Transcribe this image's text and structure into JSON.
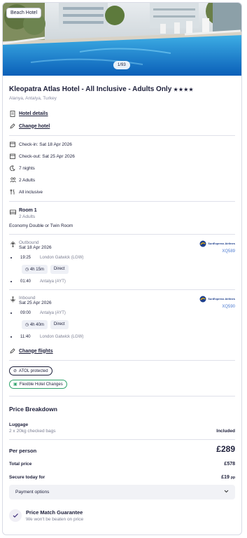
{
  "hero": {
    "tag": "Beach Hotel",
    "counter": "1/93"
  },
  "hotel": {
    "name": "Kleopatra Atlas Hotel - All Inclusive - Adults Only",
    "stars": "★★★★",
    "location": "Alanya, Antalya, Turkey",
    "details_link": "Hotel details",
    "change_link": "Change hotel"
  },
  "stay": {
    "checkin": "Check-in: Sat 18 Apr 2026",
    "checkout": "Check-out: Sat 25 Apr 2026",
    "nights": "7 nights",
    "adults": "2 Adults",
    "board": "All inclusive"
  },
  "room": {
    "title": "Room 1",
    "adults": "2 Adults",
    "type": "Economy Double or Twin Room"
  },
  "outbound": {
    "label": "Outbound",
    "date": "Sat 18 Apr 2026",
    "airline": "SunExpress Airlines",
    "code": "XQ589",
    "dep_time": "19:25",
    "dep_airport": "London Gatwick (LGW)",
    "duration": "4h 15m",
    "stops": "Direct",
    "arr_time": "01:40",
    "arr_airport": "Antalya (AYT)"
  },
  "inbound": {
    "label": "Inbound",
    "date": "Sat 25 Apr 2026",
    "airline": "SunExpress Airlines",
    "code": "XQ590",
    "dep_time": "09:00",
    "dep_airport": "Antalya (AYT)",
    "duration": "4h 40m",
    "stops": "Direct",
    "arr_time": "11:40",
    "arr_airport": "London Gatwick (LGW)"
  },
  "change_flights": "Change flights",
  "badges": {
    "atol": "ATOL protected",
    "flex": "Flexible Hotel Changes"
  },
  "price": {
    "heading": "Price Breakdown",
    "luggage_label": "Luggage",
    "luggage_desc": "2 x 20kg checked bags",
    "luggage_value": "Included",
    "per_person_label": "Per person",
    "per_person_value": "£289",
    "total_label": "Total price",
    "total_value": "£578",
    "secure_label": "Secure today for",
    "secure_value": "£19",
    "secure_suffix": "pp"
  },
  "payment_options": "Payment options",
  "guarantee": {
    "title": "Price Match Guarantee",
    "subtitle": "We won't be beaten on price"
  },
  "colors": {
    "accent_green": "#2fa36b",
    "link_blue": "#4d7bd1",
    "airline_blue": "#1e3f8c",
    "airline_yellow": "#f5b800"
  }
}
